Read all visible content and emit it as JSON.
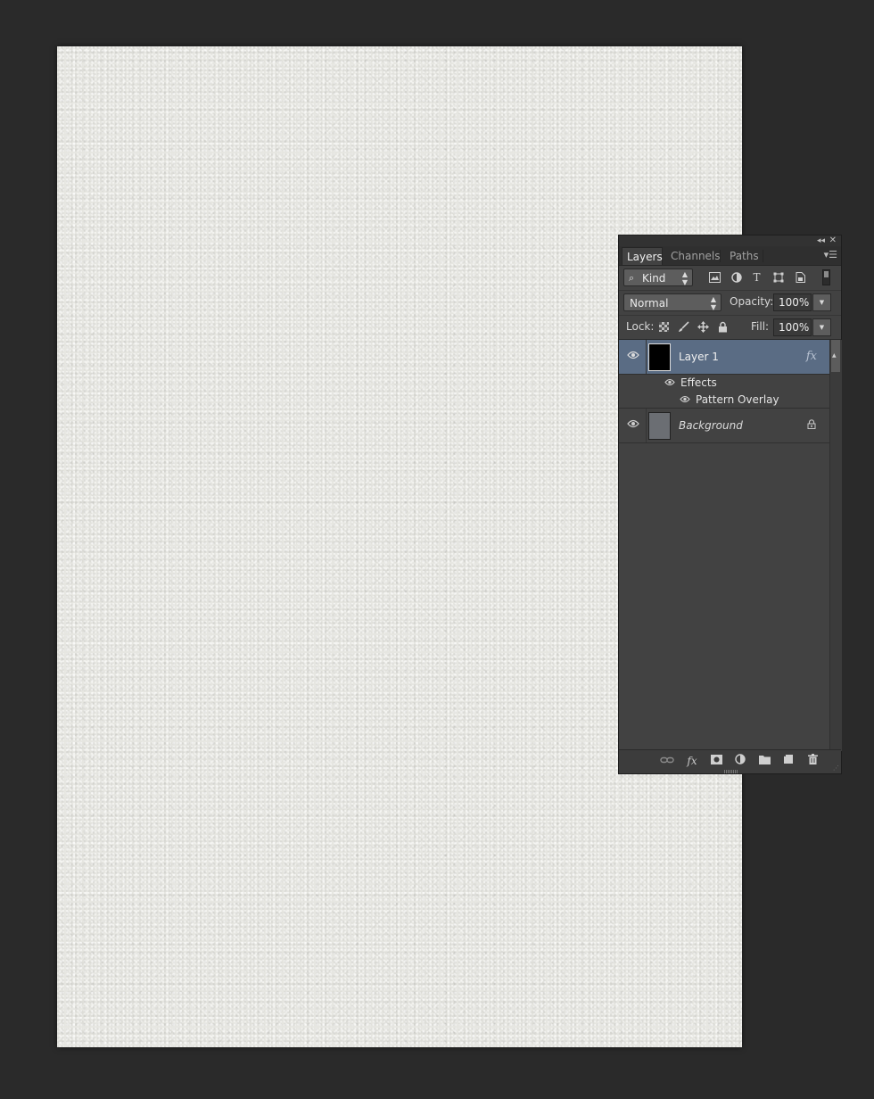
{
  "canvas": {
    "texture": "light gray paper texture"
  },
  "panel": {
    "controls": {
      "collapse": "◂◂",
      "close": "✕",
      "menu": "▾☰"
    },
    "tabs": [
      {
        "label": "Layers",
        "active": true
      },
      {
        "label": "Channels",
        "active": false
      },
      {
        "label": "Paths",
        "active": false
      }
    ],
    "filter": {
      "kind_label": "Kind",
      "icons": [
        "pixel-filter-icon",
        "adjustment-filter-icon",
        "type-filter-icon",
        "shape-filter-icon",
        "smart-object-filter-icon"
      ]
    },
    "blend": {
      "mode": "Normal",
      "opacity_label": "Opacity:",
      "opacity_value": "100%"
    },
    "lock": {
      "label": "Lock:",
      "fill_label": "Fill:",
      "fill_value": "100%"
    },
    "layers": [
      {
        "name": "Layer 1",
        "selected": true,
        "thumbnail_color": "#000000",
        "fx": "fx",
        "effects_label": "Effects",
        "effects": [
          "Pattern Overlay"
        ]
      },
      {
        "name": "Background",
        "selected": false,
        "thumbnail_color": "#6b6e73",
        "locked": true
      }
    ],
    "bottom_icons": [
      "link-layers-icon",
      "fx-icon",
      "layer-mask-icon",
      "adjustment-layer-icon",
      "new-group-icon",
      "new-layer-icon",
      "trash-icon"
    ],
    "bottom_fx_label": "fx",
    "colors": {
      "selected_row": "#5a6c84",
      "panel_bg": "#424242",
      "app_bg": "#2a2a2a"
    }
  }
}
